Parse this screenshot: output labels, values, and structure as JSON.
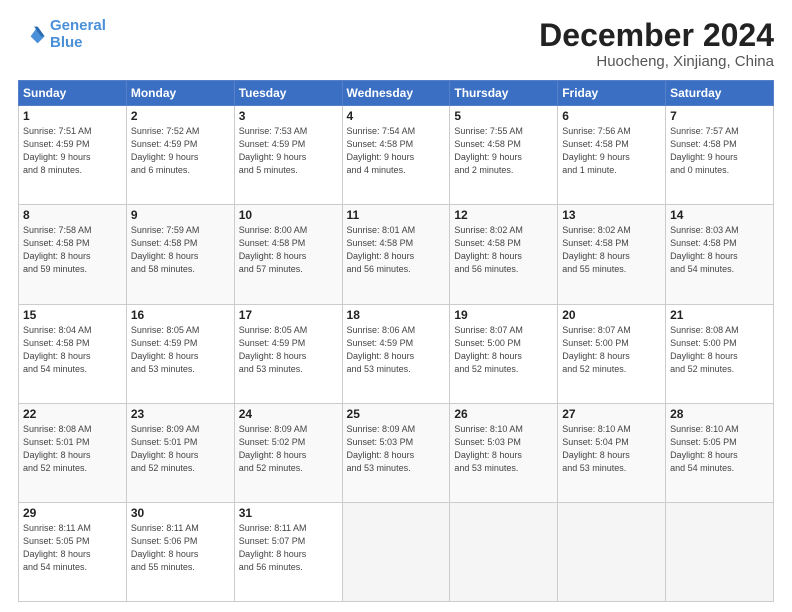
{
  "header": {
    "logo_line1": "General",
    "logo_line2": "Blue",
    "title": "December 2024",
    "subtitle": "Huocheng, Xinjiang, China"
  },
  "weekdays": [
    "Sunday",
    "Monday",
    "Tuesday",
    "Wednesday",
    "Thursday",
    "Friday",
    "Saturday"
  ],
  "weeks": [
    [
      {
        "day": "1",
        "info": "Sunrise: 7:51 AM\nSunset: 4:59 PM\nDaylight: 9 hours\nand 8 minutes."
      },
      {
        "day": "2",
        "info": "Sunrise: 7:52 AM\nSunset: 4:59 PM\nDaylight: 9 hours\nand 6 minutes."
      },
      {
        "day": "3",
        "info": "Sunrise: 7:53 AM\nSunset: 4:59 PM\nDaylight: 9 hours\nand 5 minutes."
      },
      {
        "day": "4",
        "info": "Sunrise: 7:54 AM\nSunset: 4:58 PM\nDaylight: 9 hours\nand 4 minutes."
      },
      {
        "day": "5",
        "info": "Sunrise: 7:55 AM\nSunset: 4:58 PM\nDaylight: 9 hours\nand 2 minutes."
      },
      {
        "day": "6",
        "info": "Sunrise: 7:56 AM\nSunset: 4:58 PM\nDaylight: 9 hours\nand 1 minute."
      },
      {
        "day": "7",
        "info": "Sunrise: 7:57 AM\nSunset: 4:58 PM\nDaylight: 9 hours\nand 0 minutes."
      }
    ],
    [
      {
        "day": "8",
        "info": "Sunrise: 7:58 AM\nSunset: 4:58 PM\nDaylight: 8 hours\nand 59 minutes."
      },
      {
        "day": "9",
        "info": "Sunrise: 7:59 AM\nSunset: 4:58 PM\nDaylight: 8 hours\nand 58 minutes."
      },
      {
        "day": "10",
        "info": "Sunrise: 8:00 AM\nSunset: 4:58 PM\nDaylight: 8 hours\nand 57 minutes."
      },
      {
        "day": "11",
        "info": "Sunrise: 8:01 AM\nSunset: 4:58 PM\nDaylight: 8 hours\nand 56 minutes."
      },
      {
        "day": "12",
        "info": "Sunrise: 8:02 AM\nSunset: 4:58 PM\nDaylight: 8 hours\nand 56 minutes."
      },
      {
        "day": "13",
        "info": "Sunrise: 8:02 AM\nSunset: 4:58 PM\nDaylight: 8 hours\nand 55 minutes."
      },
      {
        "day": "14",
        "info": "Sunrise: 8:03 AM\nSunset: 4:58 PM\nDaylight: 8 hours\nand 54 minutes."
      }
    ],
    [
      {
        "day": "15",
        "info": "Sunrise: 8:04 AM\nSunset: 4:58 PM\nDaylight: 8 hours\nand 54 minutes."
      },
      {
        "day": "16",
        "info": "Sunrise: 8:05 AM\nSunset: 4:59 PM\nDaylight: 8 hours\nand 53 minutes."
      },
      {
        "day": "17",
        "info": "Sunrise: 8:05 AM\nSunset: 4:59 PM\nDaylight: 8 hours\nand 53 minutes."
      },
      {
        "day": "18",
        "info": "Sunrise: 8:06 AM\nSunset: 4:59 PM\nDaylight: 8 hours\nand 53 minutes."
      },
      {
        "day": "19",
        "info": "Sunrise: 8:07 AM\nSunset: 5:00 PM\nDaylight: 8 hours\nand 52 minutes."
      },
      {
        "day": "20",
        "info": "Sunrise: 8:07 AM\nSunset: 5:00 PM\nDaylight: 8 hours\nand 52 minutes."
      },
      {
        "day": "21",
        "info": "Sunrise: 8:08 AM\nSunset: 5:00 PM\nDaylight: 8 hours\nand 52 minutes."
      }
    ],
    [
      {
        "day": "22",
        "info": "Sunrise: 8:08 AM\nSunset: 5:01 PM\nDaylight: 8 hours\nand 52 minutes."
      },
      {
        "day": "23",
        "info": "Sunrise: 8:09 AM\nSunset: 5:01 PM\nDaylight: 8 hours\nand 52 minutes."
      },
      {
        "day": "24",
        "info": "Sunrise: 8:09 AM\nSunset: 5:02 PM\nDaylight: 8 hours\nand 52 minutes."
      },
      {
        "day": "25",
        "info": "Sunrise: 8:09 AM\nSunset: 5:03 PM\nDaylight: 8 hours\nand 53 minutes."
      },
      {
        "day": "26",
        "info": "Sunrise: 8:10 AM\nSunset: 5:03 PM\nDaylight: 8 hours\nand 53 minutes."
      },
      {
        "day": "27",
        "info": "Sunrise: 8:10 AM\nSunset: 5:04 PM\nDaylight: 8 hours\nand 53 minutes."
      },
      {
        "day": "28",
        "info": "Sunrise: 8:10 AM\nSunset: 5:05 PM\nDaylight: 8 hours\nand 54 minutes."
      }
    ],
    [
      {
        "day": "29",
        "info": "Sunrise: 8:11 AM\nSunset: 5:05 PM\nDaylight: 8 hours\nand 54 minutes."
      },
      {
        "day": "30",
        "info": "Sunrise: 8:11 AM\nSunset: 5:06 PM\nDaylight: 8 hours\nand 55 minutes."
      },
      {
        "day": "31",
        "info": "Sunrise: 8:11 AM\nSunset: 5:07 PM\nDaylight: 8 hours\nand 56 minutes."
      },
      null,
      null,
      null,
      null
    ]
  ]
}
